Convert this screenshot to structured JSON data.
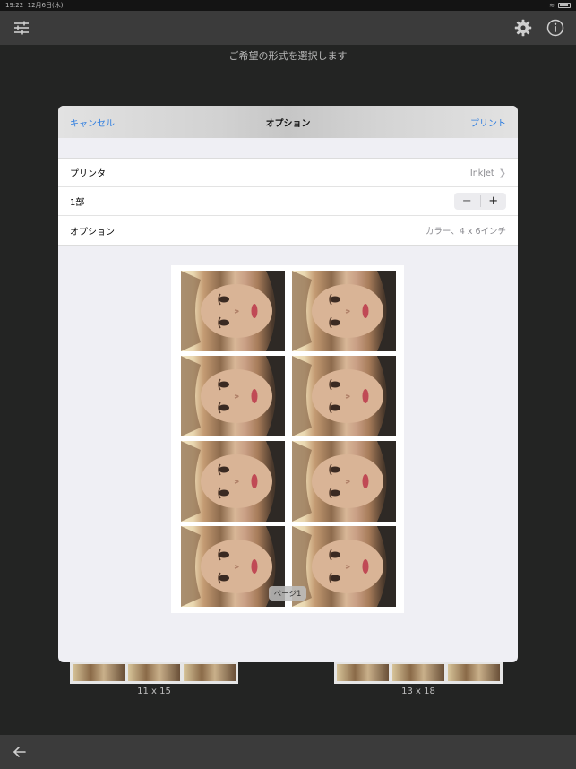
{
  "status_bar": {
    "time": "19:22",
    "date": "12月6日(木)"
  },
  "toolbar": {
    "left_icon": "sliders-icon",
    "settings_icon": "gear-icon",
    "info_icon": "info-icon"
  },
  "hint": "ご希望の形式を選択します",
  "modal": {
    "cancel": "キャンセル",
    "title": "オプション",
    "print": "プリント",
    "rows": {
      "printer": {
        "label": "プリンタ",
        "value": "InkJet"
      },
      "copies": {
        "label": "1部",
        "minus": "−",
        "plus": "+"
      },
      "options": {
        "label": "オプション",
        "value": "カラー、4 x 6インチ"
      }
    },
    "page_label": "ページ1"
  },
  "sizes": [
    {
      "label": "11 x 15"
    },
    {
      "label": "13 x 18"
    }
  ],
  "bottom_bar": {
    "back_icon": "arrow-left-icon"
  },
  "colors": {
    "accent": "#2f7ee0",
    "background": "#232423",
    "toolbar": "#3b3b3b"
  }
}
